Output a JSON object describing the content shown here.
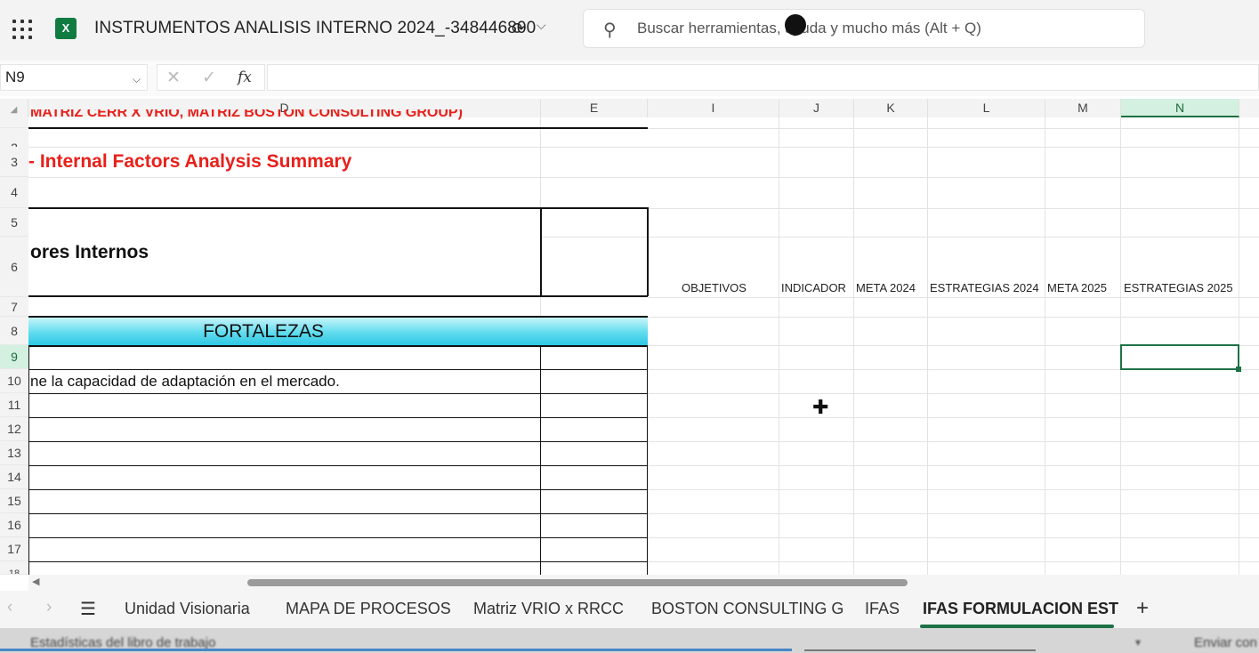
{
  "app": {
    "title": "INSTRUMENTOS ANALISIS INTERNO 2024_-348446800",
    "icon": "excel-icon",
    "brand_color": "#107c41"
  },
  "search": {
    "placeholder": "Buscar herramientas, ayuda y mucho más (Alt + Q)"
  },
  "formula_bar": {
    "name_box": "N9",
    "fx": "fx",
    "formula": ""
  },
  "columns": [
    "D",
    "E",
    "I",
    "J",
    "K",
    "L",
    "M",
    "N"
  ],
  "rows": [
    "2",
    "3",
    "4",
    "5",
    "6",
    "7",
    "8",
    "9",
    "10",
    "11",
    "12",
    "13",
    "14",
    "15",
    "16",
    "17",
    "18"
  ],
  "cells": {
    "d1_clipped": "MATRIZ CERR X VRIO, MATRIZ BOSTON CONSULTING GROUP)",
    "d3": "-  Internal Factors Analysis Summary",
    "d6": "ores Internos",
    "d8": "FORTALEZAS",
    "d10": "ne la capacidad de adaptación en el mercado.",
    "i6": "OBJETIVOS",
    "j6": "INDICADOR",
    "k6": "META 2024",
    "l6": "ESTRATEGIAS 2024",
    "m6": "META 2025",
    "n6": "ESTRATEGIAS 2025"
  },
  "colors": {
    "title_red": "#e8201a",
    "fortalezas_band": "#5fdcee",
    "selection_green": "#1e7145"
  },
  "sheets": [
    "Unidad Visionaria",
    "MAPA DE PROCESOS",
    "Matriz VRIO x RRCC",
    "BOSTON CONSULTING G",
    "IFAS",
    "IFAS FORMULACION EST"
  ],
  "active_sheet": "IFAS FORMULACION EST",
  "status": {
    "left": "Estadísticas del libro de trabajo",
    "right": "Enviar con"
  }
}
